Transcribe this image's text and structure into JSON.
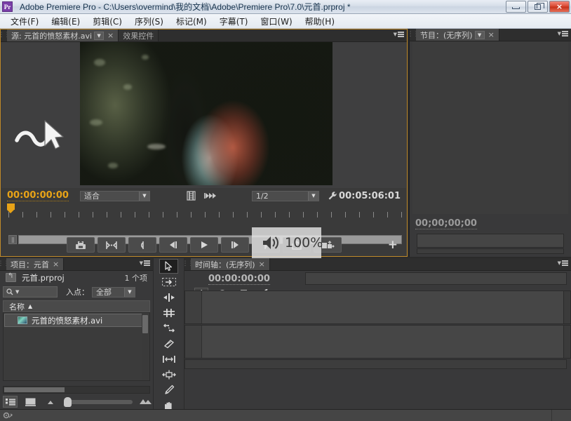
{
  "window": {
    "app_icon": "Pr",
    "title": "Adobe Premiere Pro - C:\\Users\\overmind\\我的文档\\Adobe\\Premiere Pro\\7.0\\元首.prproj *",
    "buttons": {
      "minimize": "minimize-icon",
      "restore": "restore-icon",
      "close": "×"
    }
  },
  "menubar": {
    "items": [
      {
        "label": "文件(F)",
        "name": "menu-file"
      },
      {
        "label": "编辑(E)",
        "name": "menu-edit"
      },
      {
        "label": "剪辑(C)",
        "name": "menu-clip"
      },
      {
        "label": "序列(S)",
        "name": "menu-sequence"
      },
      {
        "label": "标记(M)",
        "name": "menu-marker"
      },
      {
        "label": "字幕(T)",
        "name": "menu-title"
      },
      {
        "label": "窗口(W)",
        "name": "menu-window"
      },
      {
        "label": "帮助(H)",
        "name": "menu-help"
      }
    ]
  },
  "source_monitor": {
    "tabs": [
      {
        "label": "源: 元首的愤怒素材.avi",
        "active": true,
        "has_dropdown": true,
        "close": "×"
      },
      {
        "label": "效果控件",
        "active": false,
        "has_dropdown": false,
        "close": ""
      }
    ],
    "current_timecode": "00:00:00:00",
    "duration_timecode": "00:05:06:01",
    "fit_selector": "适合",
    "resolution_selector": "1/2",
    "volume_overlay": {
      "value": "100%",
      "icon": "speaker-icon"
    },
    "transport_buttons": [
      {
        "name": "export-frame-button",
        "icon": "export-frame-icon"
      },
      {
        "name": "mark-in-out-button",
        "icon": "mark-in-out-icon"
      },
      {
        "name": "mark-in-button",
        "icon": "mark-in-icon"
      },
      {
        "name": "step-back-button",
        "icon": "step-back-icon"
      },
      {
        "name": "play-button",
        "icon": "play-icon"
      },
      {
        "name": "step-forward-button",
        "icon": "step-forward-icon"
      },
      {
        "name": "mark-out-button",
        "icon": "mark-out-icon"
      },
      {
        "name": "insert-button",
        "icon": "insert-icon"
      },
      {
        "name": "overwrite-button",
        "icon": "overwrite-icon"
      }
    ],
    "add-button": "+"
  },
  "program_monitor": {
    "tab": {
      "label": "节目：(无序列)",
      "close": "×",
      "has_dropdown": true
    },
    "timecode": "00;00;00;00",
    "play_button": "play-icon",
    "more_button": "»",
    "add_button": "+"
  },
  "project_panel": {
    "tab": {
      "label": "项目：元首",
      "close": "×"
    },
    "project_name": "元首.prproj",
    "item_count": "1 个项",
    "search_placeholder": "",
    "in_point_label": "入点：",
    "in_point_value": "全部",
    "column_header": "名称",
    "sort_arrow": "▲",
    "items": [
      {
        "name": "元首的愤怒素材.avi",
        "icon": "clip-thumbnail"
      }
    ],
    "footer_buttons": [
      {
        "name": "list-view-button",
        "icon": "list-view-icon"
      },
      {
        "name": "icon-view-button",
        "icon": "icon-view-icon"
      },
      {
        "name": "zoom-out-icon",
        "icon": "small-mountain-icon"
      },
      {
        "name": "zoom-in-icon",
        "icon": "large-mountain-icon"
      }
    ]
  },
  "tools_panel": {
    "tools": [
      {
        "name": "selection-tool",
        "icon": "arrow-icon",
        "selected": true
      },
      {
        "name": "track-select-tool",
        "icon": "track-select-icon",
        "selected": false
      },
      {
        "name": "ripple-edit-tool",
        "icon": "ripple-edit-icon",
        "selected": false
      },
      {
        "name": "rolling-edit-tool",
        "icon": "rolling-edit-icon",
        "selected": false
      },
      {
        "name": "rate-stretch-tool",
        "icon": "rate-stretch-icon",
        "selected": false
      },
      {
        "name": "razor-tool",
        "icon": "razor-icon",
        "selected": false
      },
      {
        "name": "slip-tool",
        "icon": "slip-icon",
        "selected": false
      },
      {
        "name": "slide-tool",
        "icon": "slide-icon",
        "selected": false
      },
      {
        "name": "pen-tool",
        "icon": "pen-icon",
        "selected": false
      },
      {
        "name": "hand-tool",
        "icon": "hand-icon",
        "selected": false
      }
    ]
  },
  "timeline_panel": {
    "tab": {
      "label": "时间轴：(无序列)",
      "close": "×"
    },
    "timecode": "00:00:00:00",
    "tools": [
      {
        "name": "sync-lock-button",
        "icon": "sync-lock-icon",
        "selected": true
      },
      {
        "name": "snap-button",
        "icon": "magnet-icon",
        "selected": false
      },
      {
        "name": "marker-button",
        "icon": "marker-icon",
        "selected": false
      },
      {
        "name": "settings-button",
        "icon": "wrench-icon",
        "selected": false
      }
    ]
  },
  "colors": {
    "accent_orange": "#e8a317",
    "panel_bg": "#39393a",
    "workspace_bg": "#2b2b2b",
    "active_border": "#c08a2a"
  }
}
